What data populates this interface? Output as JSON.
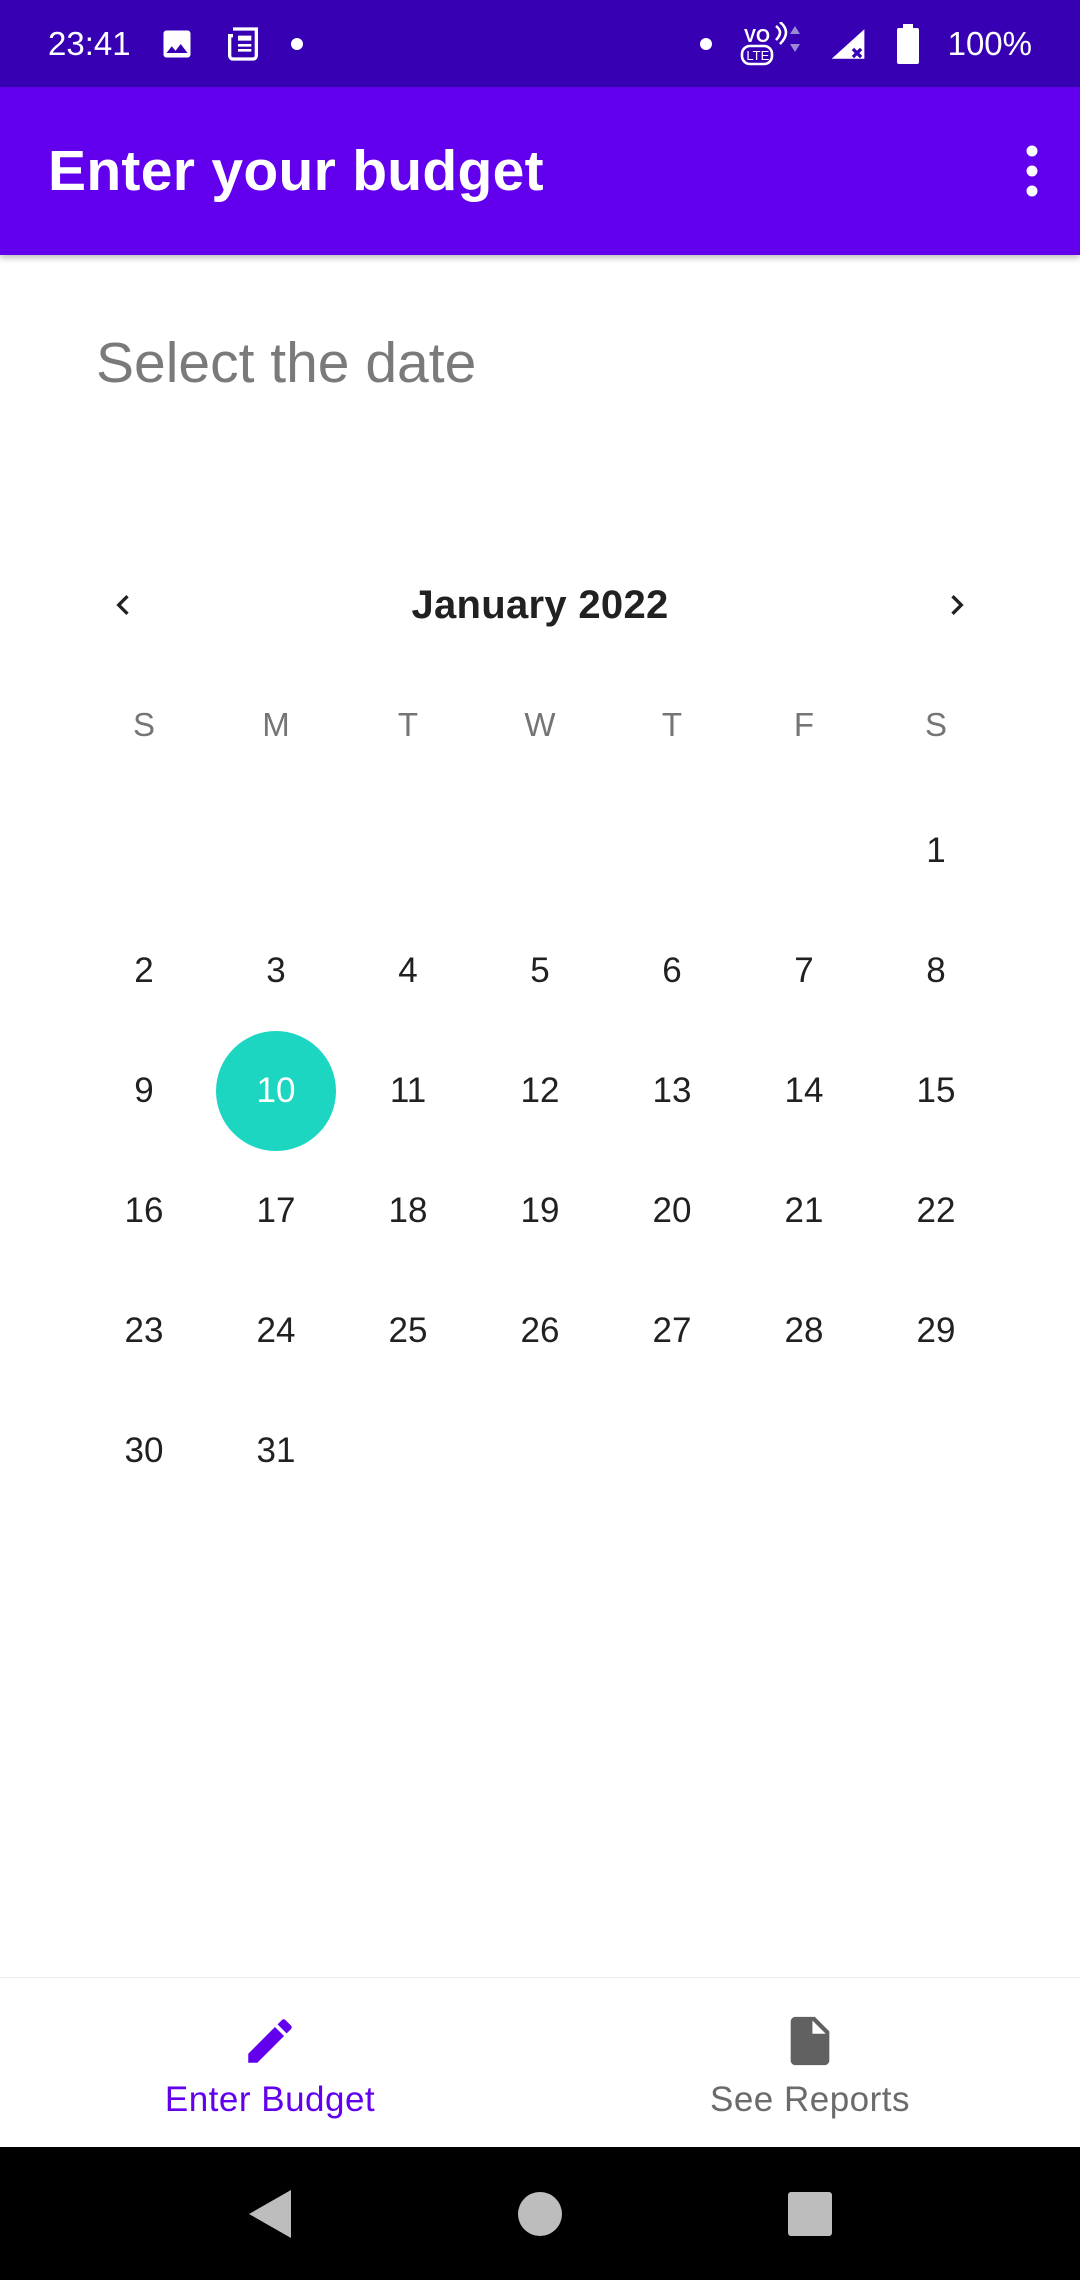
{
  "status_bar": {
    "time": "23:41",
    "battery": "100%",
    "network_label": "VoLTE"
  },
  "app_bar": {
    "title": "Enter your budget",
    "menu_icon": "more-vert-icon"
  },
  "content": {
    "date_label": "Select the date"
  },
  "calendar": {
    "month_title": "January 2022",
    "weekdays": [
      "S",
      "M",
      "T",
      "W",
      "T",
      "F",
      "S"
    ],
    "leading_blanks": 6,
    "days": [
      "1",
      "2",
      "3",
      "4",
      "5",
      "6",
      "7",
      "8",
      "9",
      "10",
      "11",
      "12",
      "13",
      "14",
      "15",
      "16",
      "17",
      "18",
      "19",
      "20",
      "21",
      "22",
      "23",
      "24",
      "25",
      "26",
      "27",
      "28",
      "29",
      "30",
      "31"
    ],
    "selected_day": "10",
    "selected_color": "#1cd6c2"
  },
  "bottom_nav": {
    "items": [
      {
        "label": "Enter Budget",
        "icon": "pencil-icon",
        "active": true
      },
      {
        "label": "See Reports",
        "icon": "document-icon",
        "active": false
      }
    ]
  },
  "colors": {
    "primary": "#6200ee",
    "primary_dark": "#3700b3",
    "accent": "#1cd6c2"
  }
}
